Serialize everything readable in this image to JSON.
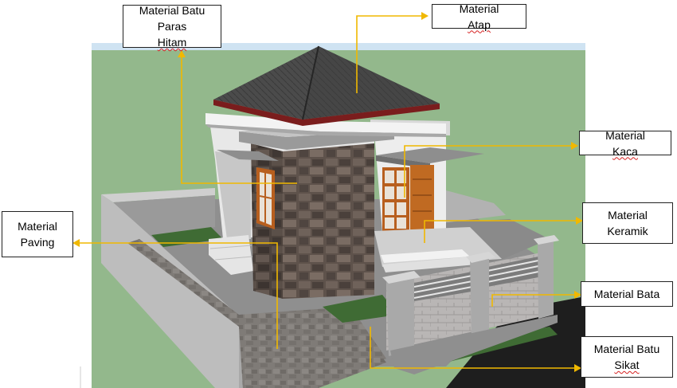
{
  "labels": {
    "batu_paras_hitam": {
      "line1_a": "Material Batu",
      "line2_a": "Paras ",
      "line2_b": "Hitam"
    },
    "atap": {
      "a": "Material ",
      "b": "Atap"
    },
    "kaca": {
      "a": "Material ",
      "b": "Kaca"
    },
    "keramik": {
      "line1": "Material",
      "line2": "Keramik"
    },
    "paving": {
      "line1": "Material",
      "line2": "Paving"
    },
    "bata": {
      "text": "Material Bata"
    },
    "batu_sikat": {
      "line1": "Material Batu",
      "line2": "Sikat"
    }
  },
  "colors": {
    "background_green": "#93b88c",
    "sky_blue": "#cfe3f2",
    "roof": "#4b4b4b",
    "stone_wall": "#5e524b",
    "paving": "#7f7b77",
    "fence_wall": "#b9b6b5",
    "grass": "#3f6b34",
    "door_wood": "#c06a22",
    "leader_line": "#f0b800"
  }
}
